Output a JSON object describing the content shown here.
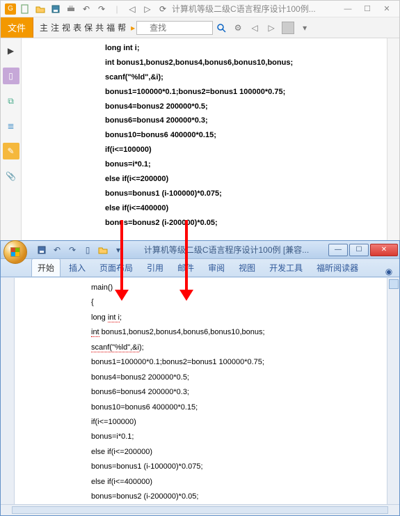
{
  "pdf": {
    "title_text": "计算机等级二级C语言程序设计100例...",
    "file_tab": "文件",
    "menu": [
      "主",
      "注",
      "视",
      "表",
      "保",
      "共",
      "福",
      "帮"
    ],
    "search_placeholder": "查找",
    "code_lines": [
      "long int i;",
      "int bonus1,bonus2,bonus4,bonus6,bonus10,bonus;",
      "  scanf(\"%ld\",&i);",
      "bonus1=100000*0.1;bonus2=bonus1 100000*0.75;",
      "bonus4=bonus2 200000*0.5;",
      "bonus6=bonus4 200000*0.3;",
      "bonus10=bonus6 400000*0.15;",
      "if(i<=100000)",
      "bonus=i*0.1;",
      "else if(i<=200000)",
      "bonus=bonus1 (i-100000)*0.075;",
      "else if(i<=400000)",
      "bonus=bonus2 (i-200000)*0.05;"
    ]
  },
  "word": {
    "title_text": "计算机等级二级C语言程序设计100例 [兼容...",
    "tabs": [
      "开始",
      "插入",
      "页面布局",
      "引用",
      "邮件",
      "审阅",
      "视图",
      "开发工具",
      "福昕阅读器"
    ],
    "active_tab_index": 0,
    "code_lines": [
      "main()",
      "{",
      "long int i;",
      "int bonus1,bonus2,bonus4,bonus6,bonus10,bonus;",
      "scanf(\"%ld\",&i);",
      "bonus1=100000*0.1;bonus2=bonus1 100000*0.75;",
      "bonus4=bonus2 200000*0.5;",
      "bonus6=bonus4 200000*0.3;",
      "bonus10=bonus6 400000*0.15;",
      "if(i<=100000)",
      "bonus=i*0.1;",
      "else if(i<=200000)",
      "bonus=bonus1 (i-100000)*0.075;",
      "else if(i<=400000)",
      "bonus=bonus2 (i-200000)*0.05;"
    ],
    "spellcheck_tokens": [
      "int i",
      "int",
      "scanf(\"%ld\",&i"
    ]
  }
}
